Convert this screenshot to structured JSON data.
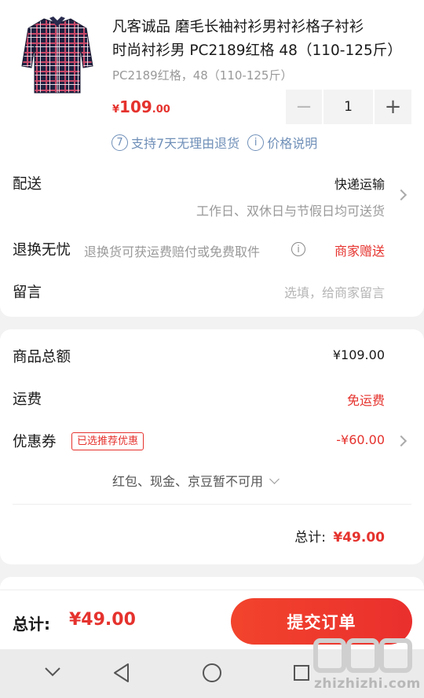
{
  "product": {
    "title_line1": "凡客诚品 磨毛长袖衬衫男衬衫格子衬衫",
    "title_line2": "时尚衬衫男 PC2189红格 48（110-125斤）",
    "spec": "PC2189红格，48（110-125斤）",
    "price_currency": "¥",
    "price_int": "109",
    "price_dec": ".00",
    "quantity": "1",
    "minus": "−",
    "plus": "+",
    "return_badge_num": "7",
    "return_text": "支持7天无理由退货",
    "price_info_icon": "i",
    "price_info_text": "价格说明"
  },
  "delivery": {
    "label": "配送",
    "method": "快递运输",
    "note": "工作日、双休日与节假日均可送货"
  },
  "returns": {
    "label": "退换无忧",
    "desc": "退换货可获运费赔付或免费取件",
    "badge": "商家赠送"
  },
  "message": {
    "label": "留言",
    "placeholder": "选填，给商家留言"
  },
  "summary": {
    "goods_label": "商品总额",
    "goods_value": "¥109.00",
    "shipping_label": "运费",
    "shipping_value": "免运费",
    "coupon_label": "优惠券",
    "coupon_tag": "已选推荐优惠",
    "coupon_value": "-¥60.00",
    "unavailable": "红包、现金、京豆暂不可用",
    "total_label": "总计:",
    "total_value": "¥49.00"
  },
  "footer": {
    "total_label": "总计:",
    "total_value": "¥49.00",
    "submit": "提交订单"
  },
  "watermark": {
    "text": "zhizhizhi.com"
  },
  "colors": {
    "accent": "#e5322d",
    "link_blue": "#6f8fb8",
    "background": "#f2f2f2"
  },
  "icons": [
    "shirt-thumbnail",
    "info-icon",
    "chevron-right-icon",
    "chevron-down-icon",
    "nav-down-icon",
    "nav-back-icon",
    "nav-home-icon",
    "nav-recents-icon"
  ]
}
